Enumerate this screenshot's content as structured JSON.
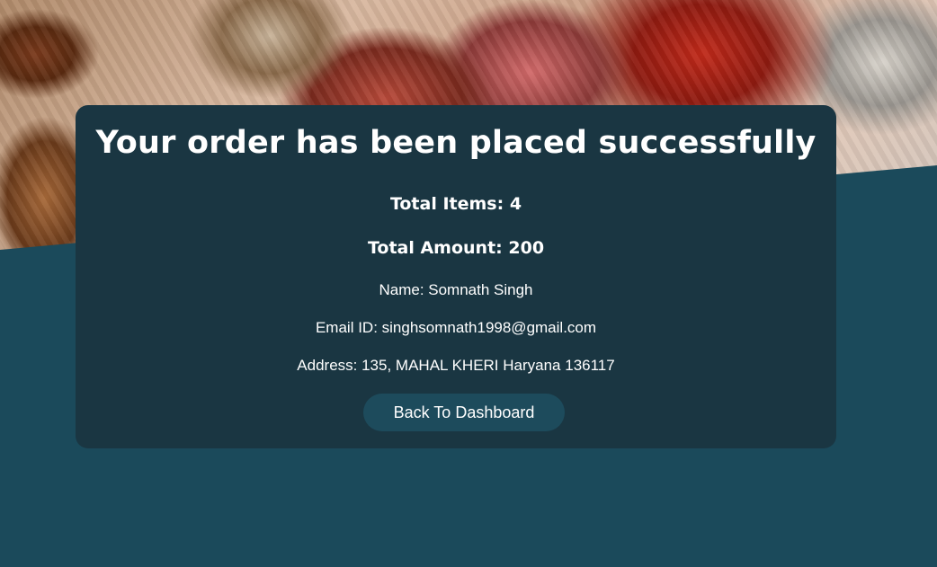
{
  "confirmation": {
    "title": "Your order has been placed successfully",
    "total_items": "Total Items: 4",
    "total_amount": "Total Amount: 200",
    "name": "Name: Somnath Singh",
    "email": "Email ID: singhsomnath1998@gmail.com",
    "address": "Address: 135, MAHAL KHERI Haryana 136117",
    "back_button_label": "Back To Dashboard"
  },
  "colors": {
    "page_background": "#1b4a5b",
    "card_background": "#1a3642",
    "button_background": "#1d4b5c",
    "text": "#ffffff"
  }
}
